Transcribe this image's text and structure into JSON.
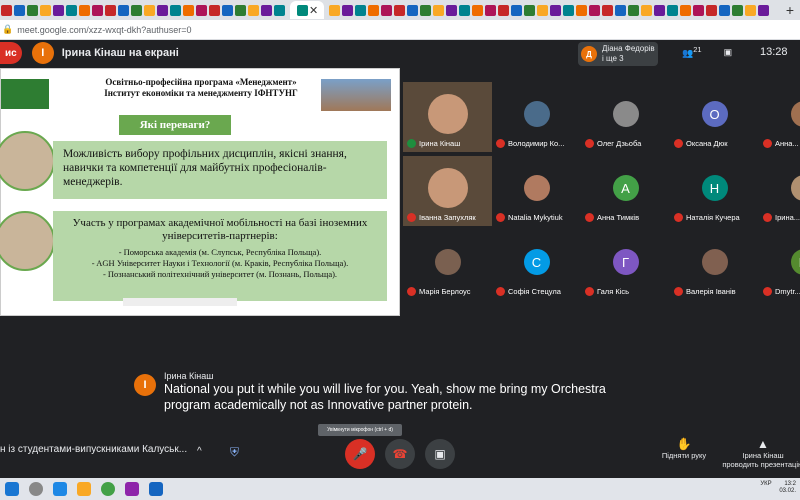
{
  "browser": {
    "tab_close": "✕",
    "new_tab": "+",
    "url": "meet.google.com/xzz-wxqt-dkh?authuser=0"
  },
  "meet": {
    "recording_label": "ис",
    "presenter_initial": "І",
    "presenter_title": "Ірина Кінаш на екрані",
    "notification": {
      "initial": "Д",
      "name": "Діана Федорів",
      "extra": "і ще 3"
    },
    "participant_count": "21",
    "time": "13:28",
    "colors": {
      "accent_red": "#d93025",
      "slide_green": "#b6d7a8",
      "banner_green": "#6aa84f"
    }
  },
  "slide": {
    "header_line1": "Освітньо-професійна програма «Менеджмент»",
    "header_line2": "Інститут економіки та менеджменту ІФНТУНГ",
    "banner": "Які переваги?",
    "box1": "Можливість вибору профільних дисциплін, якісні знання, навички та компетенції для майбутніх професіоналів-менеджерів.",
    "box2_title": "Участь у програмах академічної мобільності на базі іноземних університетів-партнерів:",
    "box2_items": [
      "- Поморська академія (м. Слупськ, Республіка Польща).",
      "- AGH Університет Науки і Технології (м. Краків, Республіка Польща).",
      "- Познанський політехнічний університет (м. Познань, Польща)."
    ]
  },
  "participants": [
    {
      "name": "Ірина Кінаш",
      "initial": "",
      "color": "#3c4043",
      "video": true
    },
    {
      "name": "Володимир Ко...",
      "initial": "",
      "color": "#4a6b8a",
      "video": false
    },
    {
      "name": "Олег Дзьоба",
      "initial": "",
      "color": "#8a8a8a",
      "video": false
    },
    {
      "name": "Оксана Дюк",
      "initial": "О",
      "color": "#5c6bc0",
      "video": false
    },
    {
      "name": "Анна...",
      "initial": "",
      "color": "#a07050",
      "video": false
    },
    {
      "name": "Іванна Запухляк",
      "initial": "",
      "color": "#3c4043",
      "video": true
    },
    {
      "name": "Natalia Mykytiuk",
      "initial": "",
      "color": "#b07a60",
      "video": false
    },
    {
      "name": "Анна Тимків",
      "initial": "А",
      "color": "#43a047",
      "video": false
    },
    {
      "name": "Наталія Кучера",
      "initial": "Н",
      "color": "#00897b",
      "video": false
    },
    {
      "name": "Ірина...",
      "initial": "",
      "color": "#b09070",
      "video": false
    },
    {
      "name": "Марія Берлоус",
      "initial": "",
      "color": "#7a6050",
      "video": false
    },
    {
      "name": "Софія Стецула",
      "initial": "С",
      "color": "#039be5",
      "video": false
    },
    {
      "name": "Галя Кісь",
      "initial": "Г",
      "color": "#7e57c2",
      "video": false
    },
    {
      "name": "Валерія Іванів",
      "initial": "",
      "color": "#806050",
      "video": false
    },
    {
      "name": "Dmytr...",
      "initial": "D",
      "color": "#558b2f",
      "video": false
    }
  ],
  "caption": {
    "initial": "І",
    "speaker": "Ірина Кінаш",
    "line1": "National you put it while you will live for you. Yeah, show me bring my Orchestra",
    "line2": "program academically not as Innovative partner protein."
  },
  "controls": {
    "tooltip": "Увімкнути мікрофон (ctrl + d)",
    "meeting_name": "н із студентами-випускниками Калуськ...",
    "chevron": "^",
    "raise_hand": "Підняти руку",
    "present_line1": "Ірина Кінаш",
    "present_line2": "проводить презентацію"
  },
  "taskbar": {
    "lang": "УКР",
    "time": "13:2",
    "date": "03.02."
  }
}
